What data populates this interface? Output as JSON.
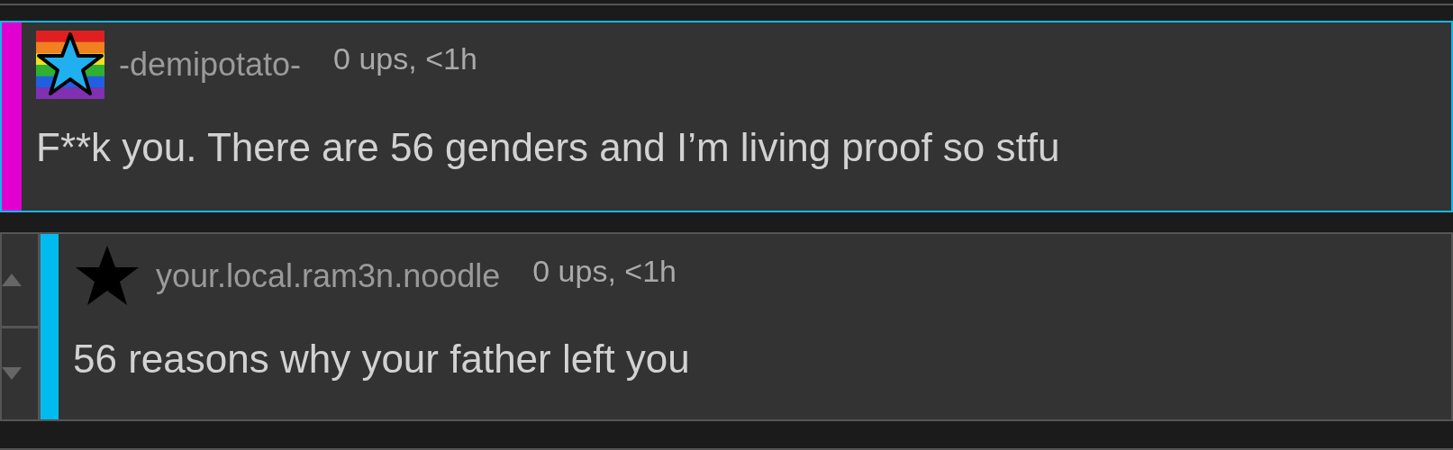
{
  "comments": [
    {
      "username": "-demipotato-",
      "meta": "0 ups, <1h",
      "text": "F**k you. There are 56 genders and I’m living proof so stfu",
      "color": "#e000d0",
      "highlighted": true,
      "vote_arrows": false,
      "avatar": {
        "kind": "flag-star"
      }
    },
    {
      "username": "your.local.ram3n.noodle",
      "meta": "0 ups, <1h",
      "text": "56 reasons why your father left you",
      "color": "#00bbee",
      "highlighted": false,
      "vote_arrows": true,
      "avatar": {
        "kind": "star"
      }
    }
  ]
}
